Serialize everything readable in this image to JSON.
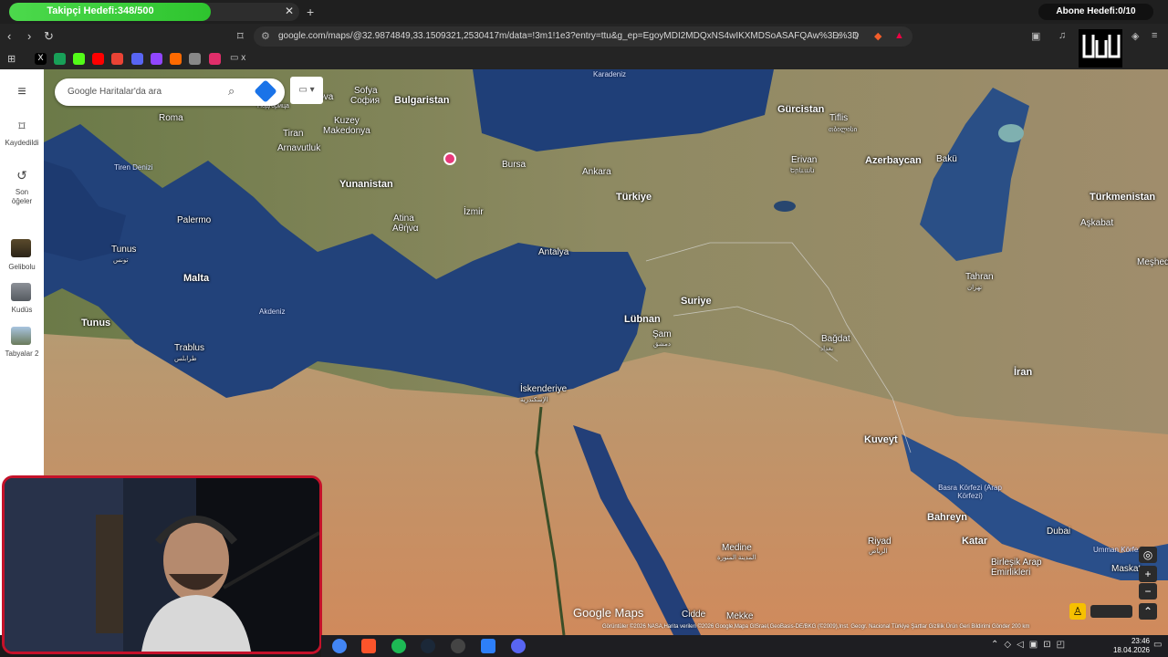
{
  "browser": {
    "tab": {
      "title": "Takipçi Hedefi:348/500",
      "progress": 0.696
    },
    "abone": "Abone Hedefi:0/10",
    "url": "google.com/maps/@32.9874849,33.1509321,2530417m/data=!3m1!1e3?entry=ttu&g_ep=EgoyMDI2MDQxNS4wIKXMDSoASAFQAw%3D%3D",
    "bookmark_folder": "x"
  },
  "sidebar": {
    "saved": "Kaydedildi",
    "recent": "Son öğeler",
    "places": [
      "Gelibolu",
      "Kudüs",
      "Tabyalar 2"
    ]
  },
  "search": {
    "placeholder": "Google Haritalar'da ara"
  },
  "map": {
    "labels": {
      "bulgaristan": "Bulgaristan",
      "sofya": "Sofya",
      "sofya_local": "София",
      "kosova": "Kosova",
      "podgorica": "Подгорица",
      "roma": "Roma",
      "kuzey_makedonya": "Kuzey Makedonya",
      "tiran": "Tiran",
      "arnavutluk": "Arnavutluk",
      "yunanistan": "Yunanistan",
      "atina": "Atina",
      "atina_local": "Αθήνα",
      "bursa": "Bursa",
      "izmir": "İzmir",
      "ankara": "Ankara",
      "turkiye": "Türkiye",
      "antalya": "Antalya",
      "gurcistan": "Gürcistan",
      "tiflis": "Tiflis",
      "tiflis_local": "თბილისი",
      "erivan": "Erivan",
      "erivan_local": "Երևան",
      "azerbaycan": "Azerbaycan",
      "baku": "Bakü",
      "turkmenistan": "Türkmenistan",
      "askabat": "Aşkabat",
      "tahran": "Tahran",
      "tahran_local": "تهران",
      "meshed": "Meşhed",
      "iran": "İran",
      "suriye": "Suriye",
      "lubnan": "Lübnan",
      "sam": "Şam",
      "sam_local": "دمشق",
      "bagdat": "Bağdat",
      "bagdat_local": "بغداد",
      "kuveyt": "Kuveyt",
      "iskenderiye": "İskenderiye",
      "iskenderiye_local": "الإسكندرية",
      "tunus_city": "Tunus",
      "tunus_local": "تونس",
      "tunus": "Tunus",
      "palermo": "Palermo",
      "malta": "Malta",
      "trablus": "Trablus",
      "trablus_local": "طرابلس",
      "medine": "Medine",
      "medine_local": "المدينة المنورة",
      "mekke": "Mekke",
      "cidde": "Cidde",
      "riyad": "Riyad",
      "riyad_local": "الرياض",
      "bahreyn": "Bahreyn",
      "katar": "Katar",
      "dubai": "Dubai",
      "birlesik": "Birleşik Arap Emirlikleri",
      "basra": "Basra Körfezi (Arap Körfezi)",
      "umman": "Umman Körfezi",
      "maskat": "Maskat",
      "karadeniz": "Karadeniz",
      "tiren": "Tiren Denizi",
      "akdeniz": "Akdeniz"
    },
    "watermark": "Google Maps",
    "footer": "Görüntüler ©2026 NASA,Harita verileri ©2026 Google,Mapa GISrael,GeoBasis-DE/BKG (©2009),Inst. Geogr. Nacional   Türkiye   Şartlar   Gizlilik   Ürün Geri Bildirimi Gönder   200 km"
  },
  "taskbar": {
    "time": "23:46",
    "date": "18.04.2026"
  }
}
